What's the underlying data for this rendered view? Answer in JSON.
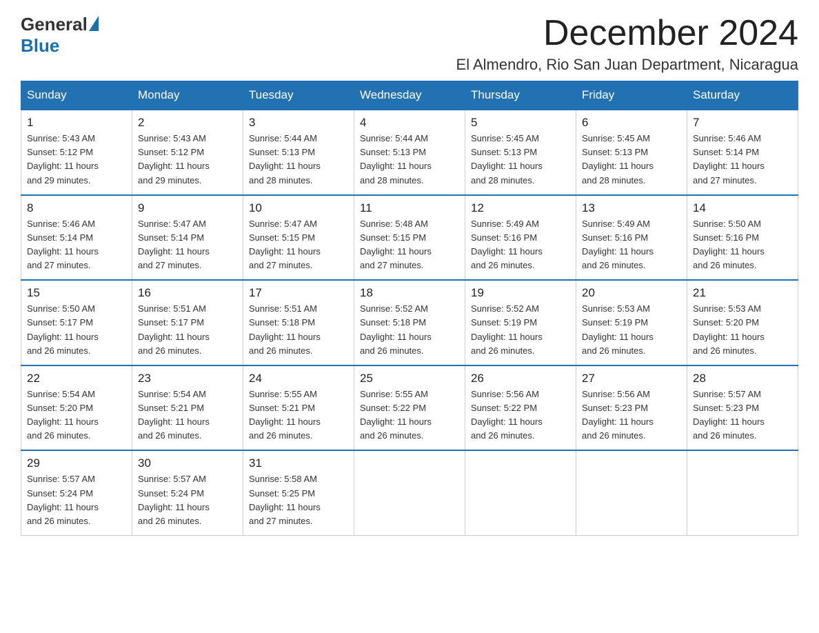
{
  "header": {
    "logo_general": "General",
    "logo_blue": "Blue",
    "month_title": "December 2024",
    "location": "El Almendro, Rio San Juan Department, Nicaragua"
  },
  "weekdays": [
    "Sunday",
    "Monday",
    "Tuesday",
    "Wednesday",
    "Thursday",
    "Friday",
    "Saturday"
  ],
  "weeks": [
    [
      {
        "day": "1",
        "sunrise": "5:43 AM",
        "sunset": "5:12 PM",
        "daylight": "11 hours and 29 minutes."
      },
      {
        "day": "2",
        "sunrise": "5:43 AM",
        "sunset": "5:12 PM",
        "daylight": "11 hours and 29 minutes."
      },
      {
        "day": "3",
        "sunrise": "5:44 AM",
        "sunset": "5:13 PM",
        "daylight": "11 hours and 28 minutes."
      },
      {
        "day": "4",
        "sunrise": "5:44 AM",
        "sunset": "5:13 PM",
        "daylight": "11 hours and 28 minutes."
      },
      {
        "day": "5",
        "sunrise": "5:45 AM",
        "sunset": "5:13 PM",
        "daylight": "11 hours and 28 minutes."
      },
      {
        "day": "6",
        "sunrise": "5:45 AM",
        "sunset": "5:13 PM",
        "daylight": "11 hours and 28 minutes."
      },
      {
        "day": "7",
        "sunrise": "5:46 AM",
        "sunset": "5:14 PM",
        "daylight": "11 hours and 27 minutes."
      }
    ],
    [
      {
        "day": "8",
        "sunrise": "5:46 AM",
        "sunset": "5:14 PM",
        "daylight": "11 hours and 27 minutes."
      },
      {
        "day": "9",
        "sunrise": "5:47 AM",
        "sunset": "5:14 PM",
        "daylight": "11 hours and 27 minutes."
      },
      {
        "day": "10",
        "sunrise": "5:47 AM",
        "sunset": "5:15 PM",
        "daylight": "11 hours and 27 minutes."
      },
      {
        "day": "11",
        "sunrise": "5:48 AM",
        "sunset": "5:15 PM",
        "daylight": "11 hours and 27 minutes."
      },
      {
        "day": "12",
        "sunrise": "5:49 AM",
        "sunset": "5:16 PM",
        "daylight": "11 hours and 26 minutes."
      },
      {
        "day": "13",
        "sunrise": "5:49 AM",
        "sunset": "5:16 PM",
        "daylight": "11 hours and 26 minutes."
      },
      {
        "day": "14",
        "sunrise": "5:50 AM",
        "sunset": "5:16 PM",
        "daylight": "11 hours and 26 minutes."
      }
    ],
    [
      {
        "day": "15",
        "sunrise": "5:50 AM",
        "sunset": "5:17 PM",
        "daylight": "11 hours and 26 minutes."
      },
      {
        "day": "16",
        "sunrise": "5:51 AM",
        "sunset": "5:17 PM",
        "daylight": "11 hours and 26 minutes."
      },
      {
        "day": "17",
        "sunrise": "5:51 AM",
        "sunset": "5:18 PM",
        "daylight": "11 hours and 26 minutes."
      },
      {
        "day": "18",
        "sunrise": "5:52 AM",
        "sunset": "5:18 PM",
        "daylight": "11 hours and 26 minutes."
      },
      {
        "day": "19",
        "sunrise": "5:52 AM",
        "sunset": "5:19 PM",
        "daylight": "11 hours and 26 minutes."
      },
      {
        "day": "20",
        "sunrise": "5:53 AM",
        "sunset": "5:19 PM",
        "daylight": "11 hours and 26 minutes."
      },
      {
        "day": "21",
        "sunrise": "5:53 AM",
        "sunset": "5:20 PM",
        "daylight": "11 hours and 26 minutes."
      }
    ],
    [
      {
        "day": "22",
        "sunrise": "5:54 AM",
        "sunset": "5:20 PM",
        "daylight": "11 hours and 26 minutes."
      },
      {
        "day": "23",
        "sunrise": "5:54 AM",
        "sunset": "5:21 PM",
        "daylight": "11 hours and 26 minutes."
      },
      {
        "day": "24",
        "sunrise": "5:55 AM",
        "sunset": "5:21 PM",
        "daylight": "11 hours and 26 minutes."
      },
      {
        "day": "25",
        "sunrise": "5:55 AM",
        "sunset": "5:22 PM",
        "daylight": "11 hours and 26 minutes."
      },
      {
        "day": "26",
        "sunrise": "5:56 AM",
        "sunset": "5:22 PM",
        "daylight": "11 hours and 26 minutes."
      },
      {
        "day": "27",
        "sunrise": "5:56 AM",
        "sunset": "5:23 PM",
        "daylight": "11 hours and 26 minutes."
      },
      {
        "day": "28",
        "sunrise": "5:57 AM",
        "sunset": "5:23 PM",
        "daylight": "11 hours and 26 minutes."
      }
    ],
    [
      {
        "day": "29",
        "sunrise": "5:57 AM",
        "sunset": "5:24 PM",
        "daylight": "11 hours and 26 minutes."
      },
      {
        "day": "30",
        "sunrise": "5:57 AM",
        "sunset": "5:24 PM",
        "daylight": "11 hours and 26 minutes."
      },
      {
        "day": "31",
        "sunrise": "5:58 AM",
        "sunset": "5:25 PM",
        "daylight": "11 hours and 27 minutes."
      },
      null,
      null,
      null,
      null
    ]
  ]
}
